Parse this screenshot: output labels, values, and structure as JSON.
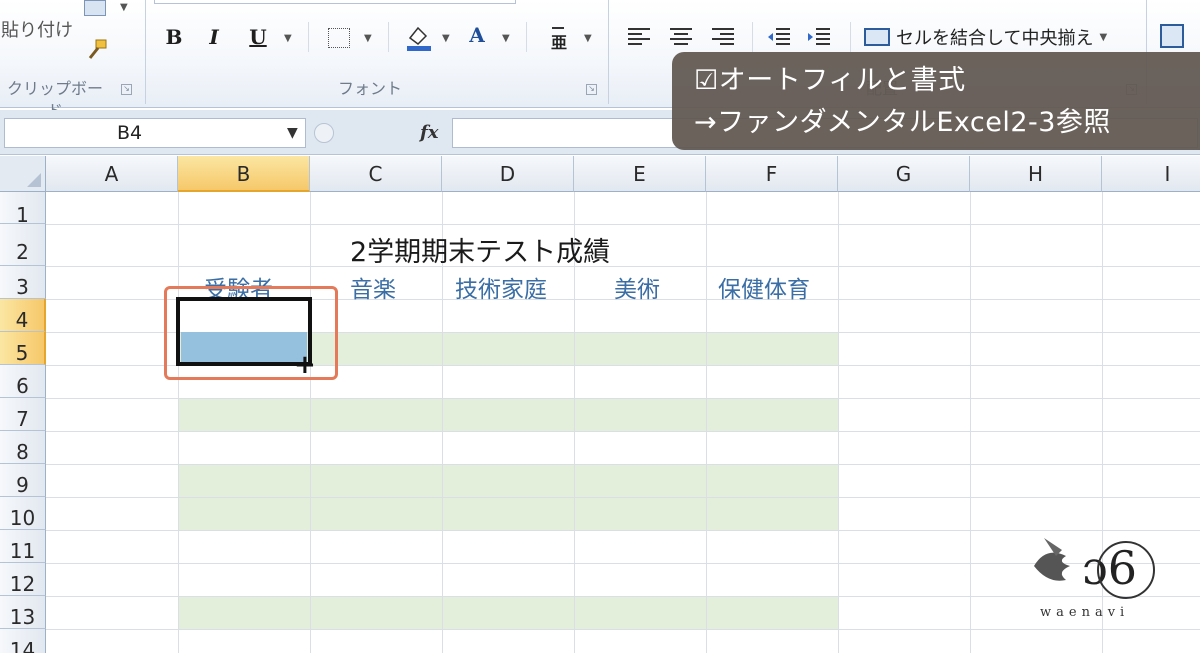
{
  "ribbon": {
    "clipboard": {
      "paste_label": "貼り付け",
      "group_label": "クリップボード"
    },
    "font": {
      "bold": "B",
      "italic": "I",
      "underline": "U",
      "font_color": "A",
      "group_label": "フォント"
    },
    "alignment": {
      "merge_center_label": "セルを結合して中央揃え",
      "group_label": "配置"
    }
  },
  "formula_bar": {
    "name_box": "B4",
    "fx": "fx",
    "formula": ""
  },
  "sheet": {
    "columns": [
      "A",
      "B",
      "C",
      "D",
      "E",
      "F",
      "G",
      "H",
      "I"
    ],
    "rows": [
      "1",
      "2",
      "3",
      "4",
      "5",
      "6",
      "7",
      "8",
      "9",
      "10",
      "11",
      "12",
      "13",
      "14"
    ],
    "title": "2学期期末テスト成績",
    "headers": [
      "受験者",
      "音楽",
      "技術家庭",
      "美術",
      "保健体育"
    ],
    "active_cell": "B4",
    "band_rows": [
      "5",
      "7",
      "9",
      "10",
      "13"
    ],
    "band_color": "#e3efdb",
    "selection_fill_color": "#95c1df"
  },
  "caption": {
    "line1": "☑オートフィルと書式",
    "line2": "→ファンダメンタルExcel2-3参照"
  },
  "logo": {
    "text": "waenavi"
  }
}
